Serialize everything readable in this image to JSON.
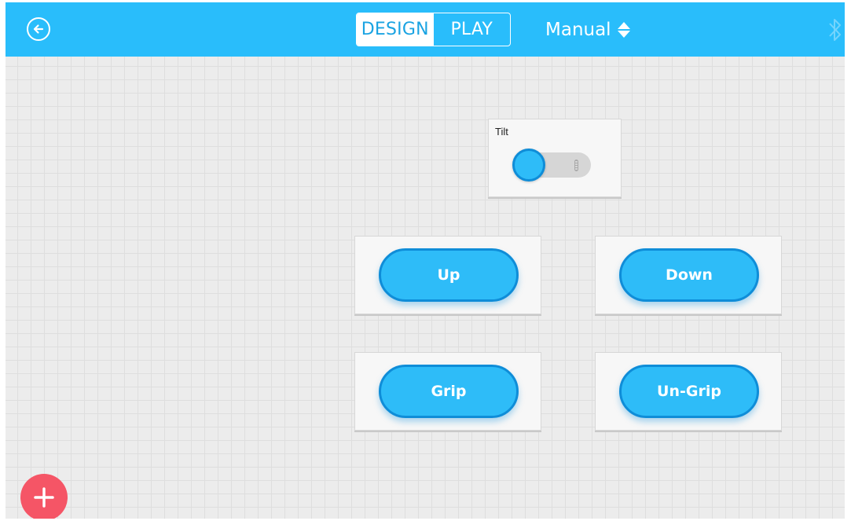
{
  "header": {
    "back_icon": "arrow-left-circle-icon",
    "mode_tabs": [
      {
        "label": "DESIGN",
        "active": true
      },
      {
        "label": "PLAY",
        "active": false
      }
    ],
    "mode_select": {
      "value": "Manual",
      "icon": "up-down-caret-icon"
    },
    "bluetooth_icon": "bluetooth-icon",
    "colors": {
      "bar": "#29bdfb",
      "active_text": "#1aa3e2"
    }
  },
  "canvas": {
    "widgets": {
      "tilt_switch": {
        "label": "Tilt",
        "state": "off"
      },
      "buttons": [
        {
          "label": "Up"
        },
        {
          "label": "Down"
        },
        {
          "label": "Grip"
        },
        {
          "label": "Un-Grip"
        }
      ]
    },
    "add_button": {
      "icon": "plus-icon",
      "color": "#f55566"
    },
    "accent_color": "#2ebcf8"
  }
}
